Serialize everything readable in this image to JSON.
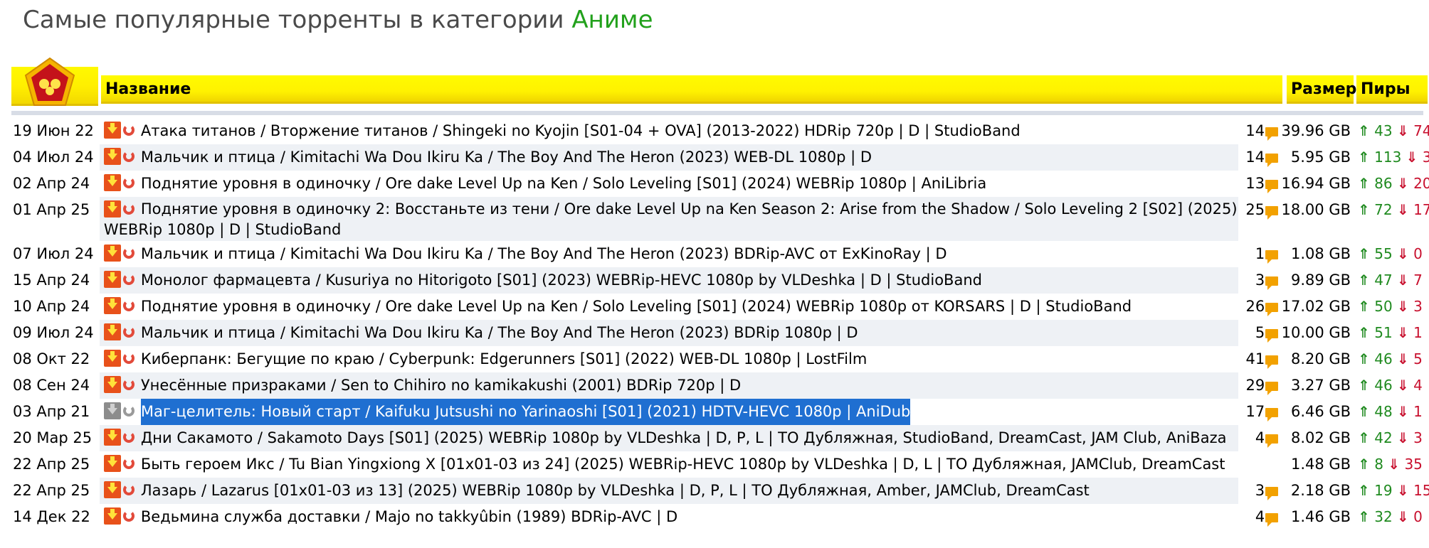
{
  "page": {
    "title_prefix": "Самые популярные торренты в категории",
    "category": "Аниме"
  },
  "table": {
    "headers": {
      "name": "Название",
      "size": "Размер",
      "peers": "Пиры"
    },
    "rows": [
      {
        "date": "19 Июн 22",
        "title": "Атака титанов / Вторжение титанов / Shingeki no Kyojin [S01-04 + OVA] (2013-2022) HDRip 720p | D | StudioBand",
        "comments": "14",
        "size": "39.96 GB",
        "seeds": "43",
        "leeches": "74"
      },
      {
        "date": "04 Июл 24",
        "title": "Мальчик и птица / Kimitachi Wa Dou Ikiru Ka / The Boy And The Heron (2023) WEB-DL 1080p | D",
        "comments": "14",
        "size": "5.95 GB",
        "seeds": "113",
        "leeches": "3"
      },
      {
        "date": "02 Апр 24",
        "title": "Поднятие уровня в одиночку / Ore dake Level Up na Ken / Solo Leveling [S01] (2024) WEBRip 1080p | AniLibria",
        "comments": "13",
        "size": "16.94 GB",
        "seeds": "86",
        "leeches": "20"
      },
      {
        "date": "01 Апр 25",
        "title": "Поднятие уровня в одиночку 2: Восстаньте из тени / Ore dake Level Up na Ken Season 2: Arise from the Shadow / Solo Leveling 2 [S02] (2025) WEBRip 1080p | D | StudioBand",
        "comments": "25",
        "size": "18.00 GB",
        "seeds": "72",
        "leeches": "17"
      },
      {
        "date": "07 Июл 24",
        "title": "Мальчик и птица / Kimitachi Wa Dou Ikiru Ka / The Boy And The Heron (2023) BDRip-AVC от ExKinoRay | D",
        "comments": "1",
        "size": "1.08 GB",
        "seeds": "55",
        "leeches": "0"
      },
      {
        "date": "15 Апр 24",
        "title": "Монолог фармацевта / Kusuriya no Hitorigoto [S01] (2023) WEBRip-HEVC 1080p by VLDeshka | D | StudioBand",
        "comments": "3",
        "size": "9.89 GB",
        "seeds": "47",
        "leeches": "7"
      },
      {
        "date": "10 Апр 24",
        "title": "Поднятие уровня в одиночку / Ore dake Level Up na Ken / Solo Leveling [S01] (2024) WEBRip 1080p от KORSARS | D | StudioBand",
        "comments": "26",
        "size": "17.02 GB",
        "seeds": "50",
        "leeches": "3"
      },
      {
        "date": "09 Июл 24",
        "title": "Мальчик и птица / Kimitachi Wa Dou Ikiru Ka / The Boy And The Heron (2023) BDRip 1080p | D",
        "comments": "5",
        "size": "10.00 GB",
        "seeds": "51",
        "leeches": "1"
      },
      {
        "date": "08 Окт 22",
        "title": "Киберпанк: Бегущие по краю / Cyberpunk: Edgerunners [S01] (2022) WEB-DL 1080p | LostFilm",
        "comments": "41",
        "size": "8.20 GB",
        "seeds": "46",
        "leeches": "5"
      },
      {
        "date": "08 Сен 24",
        "title": "Унесённые призраками / Sen to Chihiro no kamikakushi (2001) BDRip 720p | D",
        "comments": "29",
        "size": "3.27 GB",
        "seeds": "46",
        "leeches": "4"
      },
      {
        "date": "03 Апр 21",
        "title": "Маг-целитель: Новый старт / Kaifuku Jutsushi no Yarinaoshi [S01] (2021) HDTV-HEVC 1080p | AniDub",
        "comments": "17",
        "size": "6.46 GB",
        "seeds": "48",
        "leeches": "1"
      },
      {
        "date": "20 Мар 25",
        "title": "Дни Сакамото / Sakamoto Days [S01] (2025) WEBRip 1080p by VLDeshka | D, P, L | ТО Дубляжная, StudioBand, DreamCast, JAM Club, AniBaza",
        "comments": "4",
        "size": "8.02 GB",
        "seeds": "42",
        "leeches": "3"
      },
      {
        "date": "22 Апр 25",
        "title": "Быть героем Икс / Tu Bian Yingxiong X [01x01-03 из 24] (2025) WEBRip-HEVC 1080p by VLDeshka | D, L | ТО Дубляжная, JAMClub, DreamCast",
        "comments": "",
        "size": "1.48 GB",
        "seeds": "8",
        "leeches": "35"
      },
      {
        "date": "22 Апр 25",
        "title": "Лазарь / Lazarus [01x01-03 из 13] (2025) WEBRip 1080p by VLDeshka | D, P, L | ТО Дубляжная, Amber, JAMClub, DreamCast",
        "comments": "3",
        "size": "2.18 GB",
        "seeds": "19",
        "leeches": "15"
      },
      {
        "date": "14 Дек 22",
        "title": "Ведьмина служба доставки / Majo no takkyûbin (1989) BDRip-AVC | D",
        "comments": "4",
        "size": "1.46 GB",
        "seeds": "32",
        "leeches": "0"
      }
    ]
  },
  "arrows": {
    "up": "⇑",
    "down": "⇓"
  },
  "colors": {
    "header_yellow": "#fff200",
    "category_green": "#22a11c",
    "seed_green": "#1f8a1f",
    "leech_red": "#c8102e",
    "selection_blue": "#1f6fd1"
  },
  "icons": [
    "download-icon",
    "magnet-icon",
    "comment-icon",
    "logo-badge-icon"
  ]
}
